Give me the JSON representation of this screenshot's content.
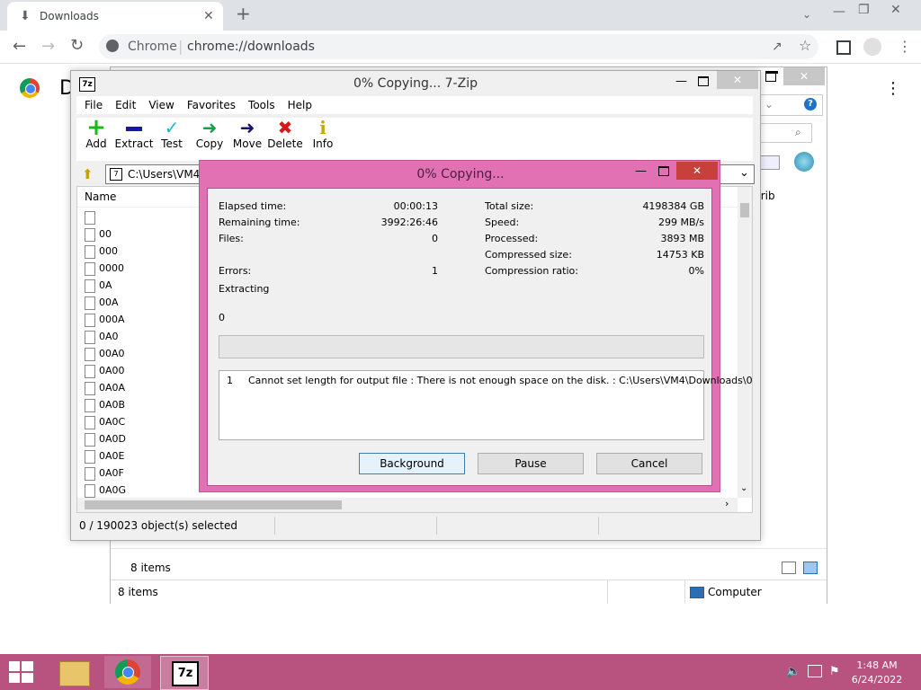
{
  "browser": {
    "tab_title": "Downloads",
    "url_site": "Chrome",
    "url_path": "chrome://downloads",
    "page_heading_partial": "D"
  },
  "explorer": {
    "status_items": "8 items",
    "status_items2": "8 items",
    "location": "Computer",
    "column_partial": "trib"
  },
  "zip": {
    "title": "0% Copying... 7-Zip",
    "logo": "7z",
    "menu": [
      "File",
      "Edit",
      "View",
      "Favorites",
      "Tools",
      "Help"
    ],
    "toolbar": [
      "Add",
      "Extract",
      "Test",
      "Copy",
      "Move",
      "Delete",
      "Info"
    ],
    "path": "C:\\Users\\VM4\\",
    "column_name": "Name",
    "files": [
      "",
      "00",
      "000",
      "0000",
      "0A",
      "00A",
      "000A",
      "0A0",
      "00A0",
      "0A00",
      "0A0A",
      "0A0B",
      "0A0C",
      "0A0D",
      "0A0E",
      "0A0F",
      "0A0G"
    ],
    "status": "0 / 190023 object(s) selected"
  },
  "dialog": {
    "title": "0% Copying...",
    "left": [
      {
        "label": "Elapsed time:",
        "value": "00:00:13"
      },
      {
        "label": "Remaining time:",
        "value": "3992:26:46"
      },
      {
        "label": "Files:",
        "value": "0"
      },
      {
        "label": "Errors:",
        "value": "1"
      }
    ],
    "right": [
      {
        "label": "Total size:",
        "value": "4198384 GB"
      },
      {
        "label": "Speed:",
        "value": "299 MB/s"
      },
      {
        "label": "Processed:",
        "value": "3893 MB"
      },
      {
        "label": "Compressed size:",
        "value": "14753 KB"
      },
      {
        "label": "Compression ratio:",
        "value": "0%"
      }
    ],
    "operation": "Extracting",
    "current_file": "0",
    "progress": 0,
    "message_index": "1",
    "message": "Cannot set length for output file : There is not enough space on the disk. : C:\\Users\\VM4\\Downloads\\0",
    "buttons": {
      "background": "Background",
      "pause": "Pause",
      "cancel": "Cancel"
    }
  },
  "taskbar": {
    "time": "1:48 AM",
    "date": "6/24/2022",
    "zip_logo": "7z"
  },
  "colors": {
    "accent": "#e271b3",
    "taskbar": "#b8527f"
  }
}
